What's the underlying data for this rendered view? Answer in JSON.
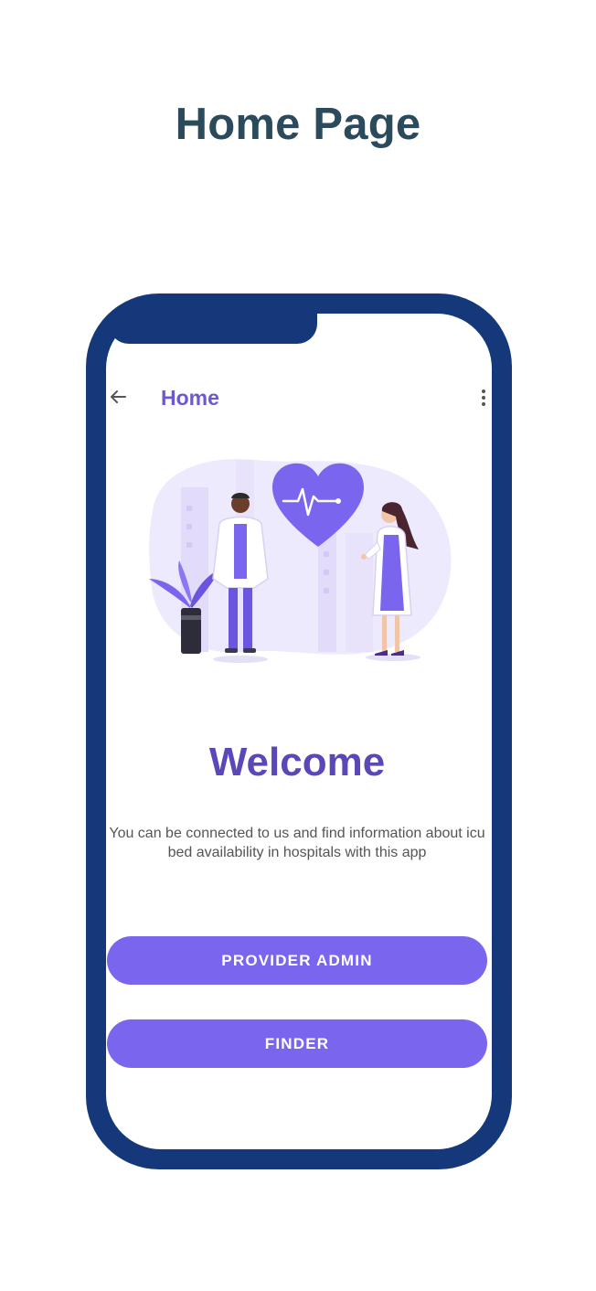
{
  "page_title": "Home Page",
  "app_bar": {
    "title": "Home",
    "back_icon": "arrow-left-icon",
    "menu_icon": "more-vertical-icon"
  },
  "welcome": {
    "heading": "Welcome",
    "description": "You can be connected to us and find information about icu bed availability in hospitals with this app"
  },
  "buttons": {
    "provider_admin": "PROVIDER ADMIN",
    "finder": "FINDER"
  },
  "colors": {
    "phone_frame": "#14387a",
    "accent": "#7a66ee",
    "heading": "#5b48b8",
    "title_text": "#2b4a5c"
  }
}
